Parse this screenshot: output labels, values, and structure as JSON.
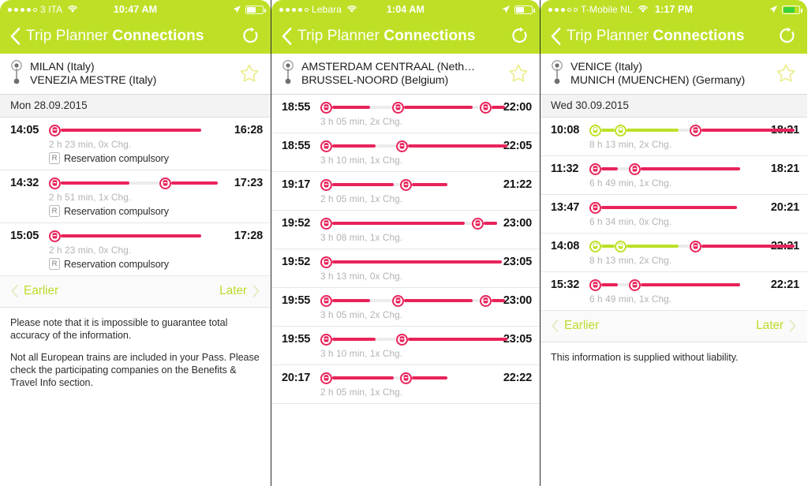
{
  "panels": [
    {
      "status": {
        "carrier": "3 ITA",
        "time": "10:47 AM",
        "signal_filled": 4,
        "signal_total": 5,
        "battery_level": 60,
        "battery_charging": false
      },
      "nav": {
        "back_label": "Trip Planner",
        "title": "Connections",
        "refresh_icon": "refresh-icon",
        "back_icon": "chevron-left-icon"
      },
      "route": {
        "origin": "MILAN (Italy)",
        "destination": "VENEZIA MESTRE (Italy)",
        "favorite_icon": "star-outline-icon",
        "pin_icon": "route-pin-icon"
      },
      "date": "Mon 28.09.2015",
      "connections": [
        {
          "departure": "14:05",
          "arrival": "16:28",
          "meta": "2 h 23 min, 0x Chg.",
          "reservation": "Reservation compulsory",
          "reservation_badge": "R",
          "segments": [
            {
              "mode": "train",
              "length": 178
            }
          ]
        },
        {
          "departure": "14:32",
          "arrival": "17:23",
          "meta": "2 h 51 min, 1x Chg.",
          "reservation": "Reservation compulsory",
          "reservation_badge": "R",
          "segments": [
            {
              "mode": "train",
              "length": 87
            },
            {
              "mode": "gap",
              "length": 38
            },
            {
              "mode": "train",
              "length": 59
            }
          ]
        },
        {
          "departure": "15:05",
          "arrival": "17:28",
          "meta": "2 h 23 min, 0x Chg.",
          "reservation": "Reservation compulsory",
          "reservation_badge": "R",
          "segments": [
            {
              "mode": "train",
              "length": 178
            }
          ]
        }
      ],
      "pager": {
        "earlier": "Earlier",
        "later": "Later"
      },
      "disclaimer": [
        "Please note that it is impossible to guarantee total accuracy of the information.",
        "Not all European trains are included in your Pass. Please check the participating companies on the Benefits & Travel Info section."
      ]
    },
    {
      "status": {
        "carrier": "Lebara",
        "time": "1:04 AM",
        "signal_filled": 4,
        "signal_total": 5,
        "battery_level": 55,
        "battery_charging": false
      },
      "nav": {
        "back_label": "Trip Planner",
        "title": "Connections",
        "refresh_icon": "refresh-icon",
        "back_icon": "chevron-left-icon"
      },
      "route": {
        "origin": "AMSTERDAM CENTRAAL (Neth…",
        "destination": "BRUSSEL-NOORD (Belgium)",
        "favorite_icon": "star-outline-icon",
        "pin_icon": "route-pin-icon"
      },
      "date": null,
      "connections": [
        {
          "departure": "18:55",
          "arrival": "22:00",
          "meta": "3 h 05 min, 2x Chg.",
          "segments": [
            {
              "mode": "train",
              "length": 48
            },
            {
              "mode": "gap",
              "length": 28
            },
            {
              "mode": "train",
              "length": 87
            },
            {
              "mode": "gap",
              "length": 9
            },
            {
              "mode": "train",
              "length": 17
            }
          ]
        },
        {
          "departure": "18:55",
          "arrival": "22:05",
          "meta": "3 h 10 min, 1x Chg.",
          "segments": [
            {
              "mode": "train",
              "length": 55
            },
            {
              "mode": "gap",
              "length": 26
            },
            {
              "mode": "train",
              "length": 126
            }
          ]
        },
        {
          "departure": "19:17",
          "arrival": "21:22",
          "meta": "2 h 05 min, 1x Chg.",
          "segments": [
            {
              "mode": "train",
              "length": 78
            },
            {
              "mode": "gap",
              "length": 8
            },
            {
              "mode": "train",
              "length": 45
            }
          ]
        },
        {
          "departure": "19:52",
          "arrival": "23:00",
          "meta": "3 h 08 min, 1x Chg.",
          "segments": [
            {
              "mode": "train",
              "length": 168
            },
            {
              "mode": "gap",
              "length": 9
            },
            {
              "mode": "train",
              "length": 17
            }
          ]
        },
        {
          "departure": "19:52",
          "arrival": "23:05",
          "meta": "3 h 13 min, 0x Chg.",
          "segments": [
            {
              "mode": "train",
              "length": 215
            }
          ]
        },
        {
          "departure": "19:55",
          "arrival": "23:00",
          "meta": "3 h 05 min, 2x Chg.",
          "segments": [
            {
              "mode": "train",
              "length": 48
            },
            {
              "mode": "gap",
              "length": 28
            },
            {
              "mode": "train",
              "length": 87
            },
            {
              "mode": "gap",
              "length": 9
            },
            {
              "mode": "train",
              "length": 17
            }
          ]
        },
        {
          "departure": "19:55",
          "arrival": "23:05",
          "meta": "3 h 10 min, 1x Chg.",
          "segments": [
            {
              "mode": "train",
              "length": 55
            },
            {
              "mode": "gap",
              "length": 26
            },
            {
              "mode": "train",
              "length": 126
            }
          ]
        },
        {
          "departure": "20:17",
          "arrival": "22:22",
          "meta": "2 h 05 min, 1x Chg.",
          "segments": [
            {
              "mode": "train",
              "length": 78
            },
            {
              "mode": "gap",
              "length": 8
            },
            {
              "mode": "train",
              "length": 45
            }
          ]
        }
      ],
      "pager": null,
      "disclaimer": []
    },
    {
      "status": {
        "carrier": "T-Mobile NL",
        "time": "1:17 PM",
        "signal_filled": 3,
        "signal_total": 5,
        "battery_level": 75,
        "battery_charging": true
      },
      "nav": {
        "back_label": "Trip Planner",
        "title": "Connections",
        "refresh_icon": "refresh-icon",
        "back_icon": "chevron-left-icon"
      },
      "route": {
        "origin": "VENICE (Italy)",
        "destination": "MUNICH (MUENCHEN) (Germany)",
        "favorite_icon": "star-outline-icon",
        "pin_icon": "route-pin-icon"
      },
      "date": "Wed 30.09.2015",
      "connections": [
        {
          "departure": "10:08",
          "arrival": "18:21",
          "meta": "8 h 13 min, 2x Chg.",
          "segments": [
            {
              "mode": "bus",
              "length": 17
            },
            {
              "mode": "bus_icon",
              "length": 0
            },
            {
              "mode": "bus",
              "length": 66
            },
            {
              "mode": "gap",
              "length": 14
            },
            {
              "mode": "train",
              "length": 118
            }
          ]
        },
        {
          "departure": "11:32",
          "arrival": "18:21",
          "meta": "6 h 49 min, 1x Chg.",
          "segments": [
            {
              "mode": "train",
              "length": 21
            },
            {
              "mode": "gap",
              "length": 14
            },
            {
              "mode": "train",
              "length": 126
            }
          ]
        },
        {
          "departure": "13:47",
          "arrival": "20:21",
          "meta": "6 h 34 min, 0x Chg.",
          "segments": [
            {
              "mode": "train",
              "length": 172
            }
          ]
        },
        {
          "departure": "14:08",
          "arrival": "22:21",
          "meta": "8 h 13 min, 2x Chg.",
          "segments": [
            {
              "mode": "bus",
              "length": 17
            },
            {
              "mode": "bus_icon",
              "length": 0
            },
            {
              "mode": "bus",
              "length": 66
            },
            {
              "mode": "gap",
              "length": 14
            },
            {
              "mode": "train",
              "length": 118
            }
          ]
        },
        {
          "departure": "15:32",
          "arrival": "22:21",
          "meta": "6 h 49 min, 1x Chg.",
          "segments": [
            {
              "mode": "train",
              "length": 21
            },
            {
              "mode": "gap",
              "length": 14
            },
            {
              "mode": "train",
              "length": 126
            }
          ]
        }
      ],
      "pager": {
        "earlier": "Earlier",
        "later": "Later"
      },
      "disclaimer": [
        "This information is supplied without liability."
      ]
    }
  ],
  "colors": {
    "brand_green": "#bde027",
    "accent_red": "#e8235a",
    "gap_gray": "#ececec",
    "meta_gray": "#b3b3b3",
    "star_yellow": "#ecec8a"
  }
}
